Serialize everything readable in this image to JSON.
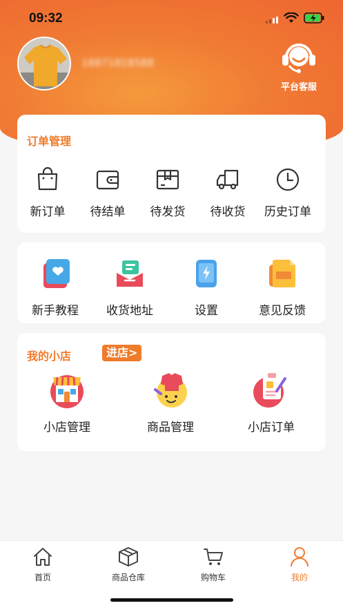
{
  "status_bar": {
    "time": "09:32"
  },
  "profile": {
    "phone_masked": "18871818588"
  },
  "service": {
    "label": "平台客服"
  },
  "order_card": {
    "title": "订单管理",
    "items": [
      {
        "label": "新订单",
        "icon": "shopping-bag-icon"
      },
      {
        "label": "待结单",
        "icon": "wallet-icon"
      },
      {
        "label": "待发货",
        "icon": "package-icon"
      },
      {
        "label": "待收货",
        "icon": "truck-icon"
      },
      {
        "label": "历史订单",
        "icon": "clock-icon"
      }
    ]
  },
  "tools_card": {
    "items": [
      {
        "label": "新手教程",
        "icon": "tutorial-icon"
      },
      {
        "label": "收货地址",
        "icon": "address-icon"
      },
      {
        "label": "设置",
        "icon": "settings-phone-icon"
      },
      {
        "label": "意见反馈",
        "icon": "feedback-icon"
      }
    ]
  },
  "shop_card": {
    "title": "我的小店",
    "enter_label": "进店>",
    "items": [
      {
        "label": "小店管理",
        "icon": "storefront-icon"
      },
      {
        "label": "商品管理",
        "icon": "product-icon"
      },
      {
        "label": "小店订单",
        "icon": "shop-order-icon"
      }
    ]
  },
  "tabbar": {
    "items": [
      {
        "label": "首页",
        "icon": "home-icon"
      },
      {
        "label": "商品仓库",
        "icon": "box-icon"
      },
      {
        "label": "购物车",
        "icon": "cart-icon"
      },
      {
        "label": "我的",
        "icon": "user-icon"
      }
    ],
    "active_color": "#f07b2a"
  },
  "colors": {
    "accent": "#f07b2a",
    "header": "#ee6b30"
  }
}
